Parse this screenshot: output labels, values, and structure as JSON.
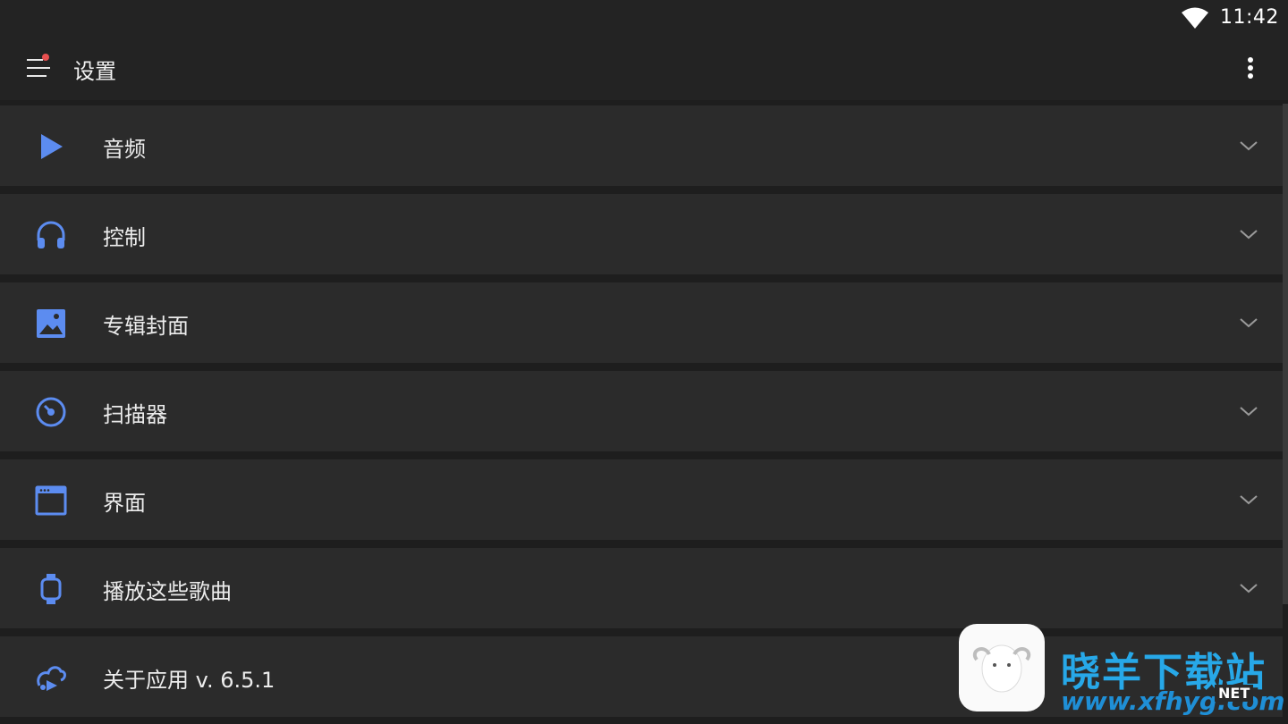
{
  "status_bar": {
    "time": "11:42",
    "wifi_icon": "wifi-icon"
  },
  "app_bar": {
    "title": "设置",
    "menu_icon": "menu-icon",
    "overflow_icon": "more-vert-icon",
    "accent": "#e85050"
  },
  "colors": {
    "icon_accent": "#5c8cf0",
    "background": "#1e1e1e",
    "row": "#2b2b2b"
  },
  "settings": [
    {
      "label": "音频",
      "icon": "play-icon"
    },
    {
      "label": "控制",
      "icon": "headphones-icon"
    },
    {
      "label": "专辑封面",
      "icon": "image-icon"
    },
    {
      "label": "扫描器",
      "icon": "scanner-icon"
    },
    {
      "label": "界面",
      "icon": "window-icon"
    },
    {
      "label": "播放这些歌曲",
      "icon": "watch-icon"
    },
    {
      "label": "关于应用 v. 6.5.1",
      "icon": "app-logo-icon"
    }
  ],
  "watermark": {
    "title": "晓羊下载站",
    "domain": "www.xfhyg.com",
    "net": "NET"
  }
}
